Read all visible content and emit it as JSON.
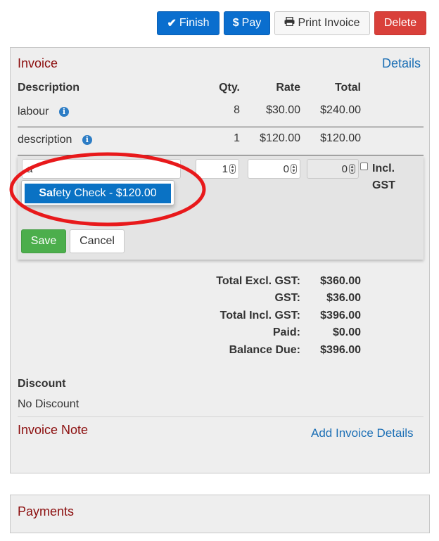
{
  "toolbar": {
    "finish_label": "Finish",
    "pay_label": "Pay",
    "print_label": "Print Invoice",
    "delete_label": "Delete"
  },
  "invoice": {
    "heading": "Invoice",
    "details_link": "Details",
    "columns": {
      "description": "Description",
      "qty": "Qty.",
      "rate": "Rate",
      "total": "Total"
    },
    "lines": [
      {
        "description": "labour",
        "qty": "8",
        "rate": "$30.00",
        "total": "$240.00"
      },
      {
        "description": "description",
        "qty": "1",
        "rate": "$120.00",
        "total": "$120.00"
      }
    ],
    "new_line": {
      "description_value": "a",
      "qty_value": "1",
      "rate_value": "0",
      "total_value": "0",
      "incl_gst_label": "Incl. GST",
      "incl_gst_checked": false,
      "autocomplete_suggestion": "Safety Check - $120.00",
      "autocomplete_match_part": "Sa",
      "autocomplete_rest": "fety Check - $120.00",
      "save_label": "Save",
      "cancel_label": "Cancel"
    },
    "totals": [
      {
        "label": "Total Excl. GST:",
        "value": "$360.00"
      },
      {
        "label": "GST:",
        "value": "$36.00"
      },
      {
        "label": "Total Incl. GST:",
        "value": "$396.00"
      },
      {
        "label": "Paid:",
        "value": "$0.00"
      },
      {
        "label": "Balance Due:",
        "value": "$396.00"
      }
    ],
    "discount_heading": "Discount",
    "discount_value": "No Discount",
    "note_heading": "Invoice Note",
    "add_details_link": "Add Invoice Details"
  },
  "payments": {
    "heading": "Payments"
  },
  "colors": {
    "primary": "#0a6ece",
    "danger": "#d9403a",
    "success": "#4cae4c",
    "heading_red": "#8b0d0d",
    "link_blue": "#1c6fb5",
    "annotation_circle": "#e8191b"
  },
  "icons": {
    "finish": "check-icon",
    "pay": "dollar-icon",
    "print": "printer-icon",
    "info": "info-icon"
  }
}
